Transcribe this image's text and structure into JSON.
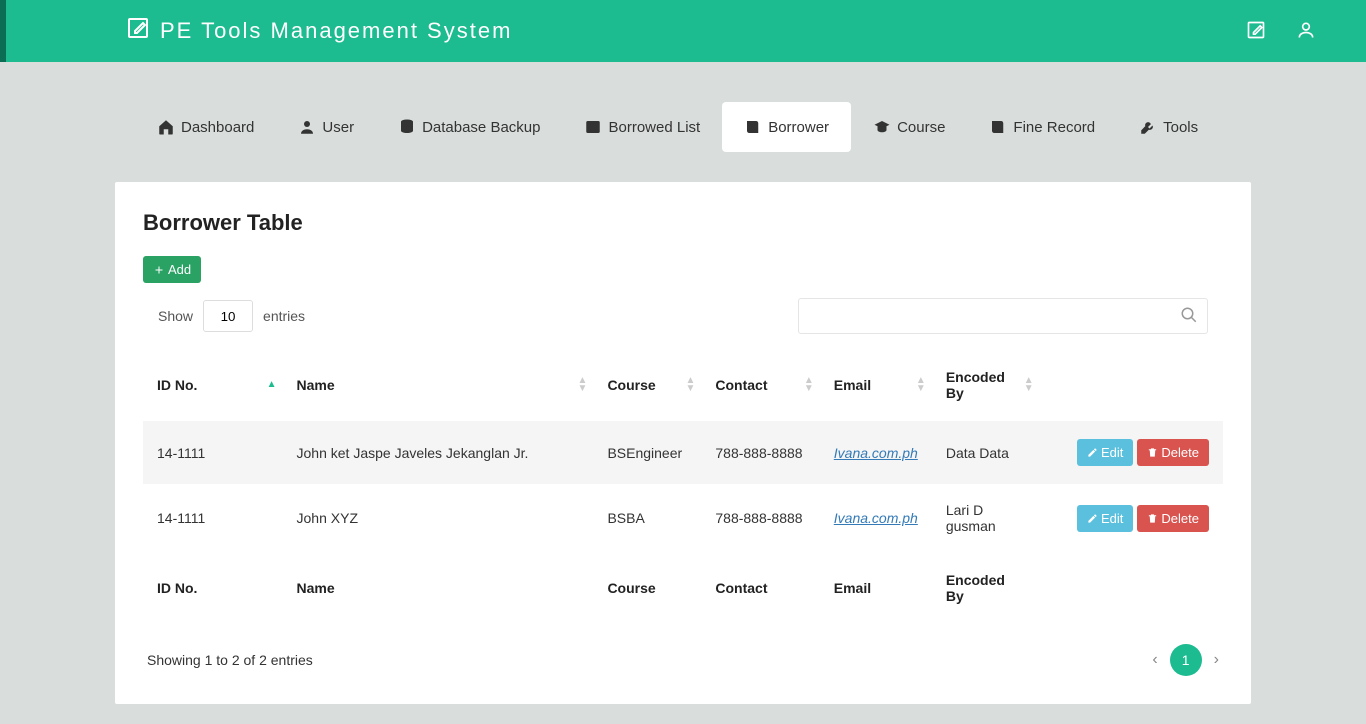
{
  "brand": "PE  Tools  Management  System",
  "nav": [
    {
      "label": "Dashboard",
      "icon": "home"
    },
    {
      "label": "User",
      "icon": "user"
    },
    {
      "label": "Database Backup",
      "icon": "database"
    },
    {
      "label": "Borrowed List",
      "icon": "list"
    },
    {
      "label": "Borrower",
      "icon": "book",
      "active": true
    },
    {
      "label": "Course",
      "icon": "gradcap"
    },
    {
      "label": "Fine Record",
      "icon": "book"
    },
    {
      "label": "Tools",
      "icon": "wrench"
    }
  ],
  "panel": {
    "title": "Borrower Table",
    "add_label": "Add",
    "show_label": "Show",
    "entries_label": "entries",
    "entries_value": "10"
  },
  "columns": [
    "ID No.",
    "Name",
    "Course",
    "Contact",
    "Email",
    "Encoded By"
  ],
  "rows": [
    {
      "id": "14-1111",
      "name": "John ket Jaspe Javeles Jekanglan Jr.",
      "course": "BSEngineer",
      "contact": "788-888-8888",
      "email": "Ivana.com.ph",
      "encoded": "Data Data"
    },
    {
      "id": "14-1111",
      "name": "John XYZ",
      "course": "BSBA",
      "contact": "788-888-8888",
      "email": "Ivana.com.ph",
      "encoded": "Lari D gusman"
    }
  ],
  "actions": {
    "edit": "Edit",
    "delete": "Delete"
  },
  "footer": {
    "info": "Showing 1 to 2 of 2 entries",
    "page": "1"
  }
}
